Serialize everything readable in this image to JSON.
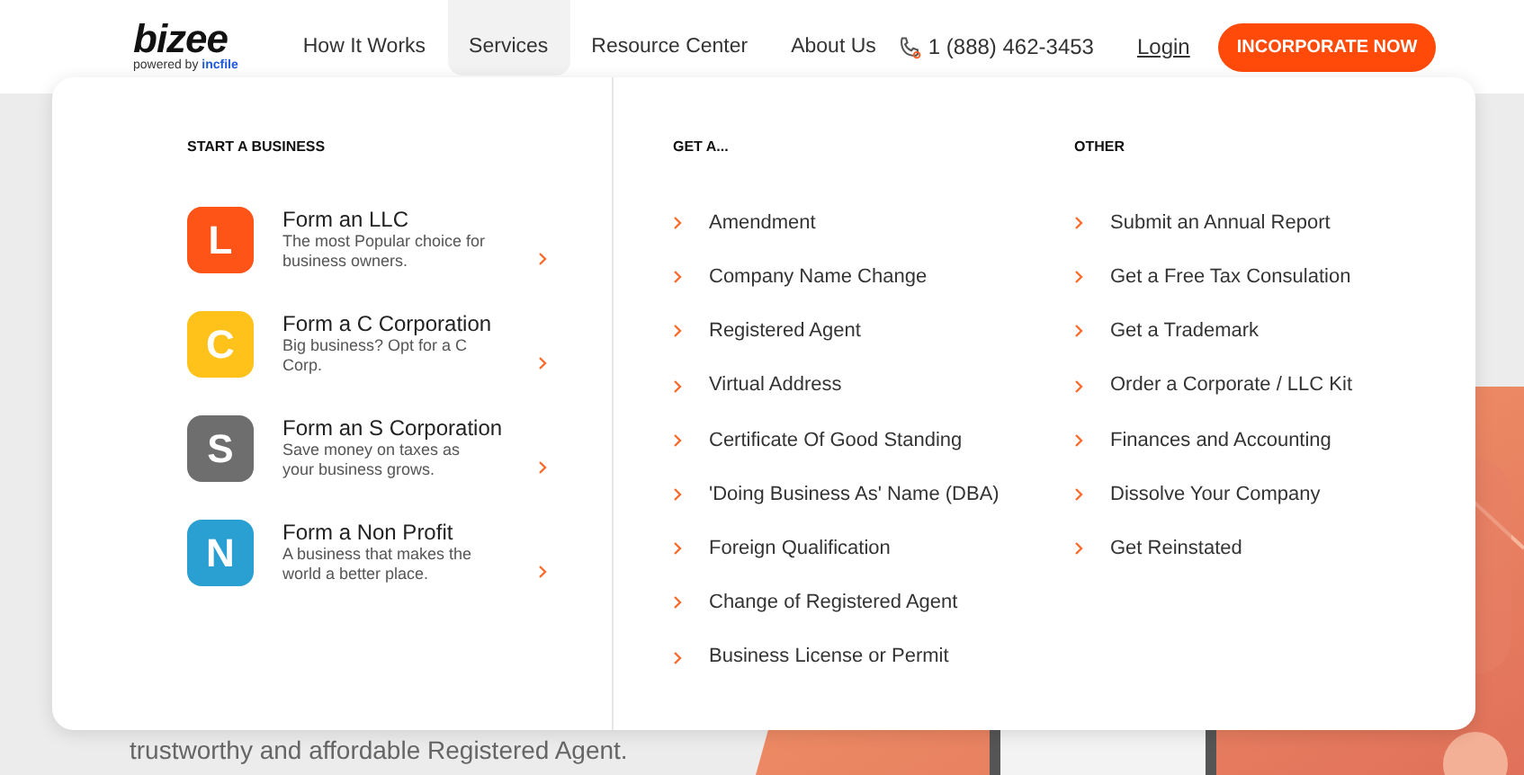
{
  "header": {
    "logo": "bizee",
    "tagline": "powered by",
    "tagline_brand": "incfile",
    "nav": [
      {
        "label": "How It Works",
        "selected": false
      },
      {
        "label": "Services",
        "selected": true
      },
      {
        "label": "Resource Center",
        "selected": false
      },
      {
        "label": "About Us",
        "selected": false
      }
    ],
    "phone": "1 (888) 462-3453",
    "login": "Login",
    "cta": "INCORPORATE NOW"
  },
  "menu": {
    "start": {
      "heading": "START A BUSINESS",
      "items": [
        {
          "letter": "L",
          "title": "Form an LLC",
          "description": "The most Popular choice for business owners.",
          "color": "#ff5418"
        },
        {
          "letter": "C",
          "title": "Form a C Corporation",
          "description": "Big business? Opt for a C Corp.",
          "color": "#ffc21a"
        },
        {
          "letter": "S",
          "title": "Form an S Corporation",
          "description": "Save money on taxes as your business grows.",
          "color": "#6e6e6e"
        },
        {
          "letter": "N",
          "title": "Form a Non Profit",
          "description": "A business that makes the world a better place.",
          "color": "#2a9fd2"
        }
      ]
    },
    "get": {
      "heading": "GET A...",
      "items": [
        "Amendment",
        "Company Name Change",
        "Registered Agent",
        "Virtual Address",
        "Certificate Of Good Standing",
        "'Doing Business As' Name (DBA)",
        "Foreign Qualification",
        "Change of Registered Agent",
        "Business License or Permit"
      ]
    },
    "other": {
      "heading": "OTHER",
      "items": [
        "Submit an Annual Report",
        "Get a Free Tax Consulation",
        "Get a Trademark",
        "Order a Corporate / LLC Kit",
        "Finances and Accounting",
        "Dissolve Your Company",
        "Get Reinstated"
      ]
    }
  },
  "hero": {
    "text": "trustworthy and affordable Registered Agent."
  }
}
